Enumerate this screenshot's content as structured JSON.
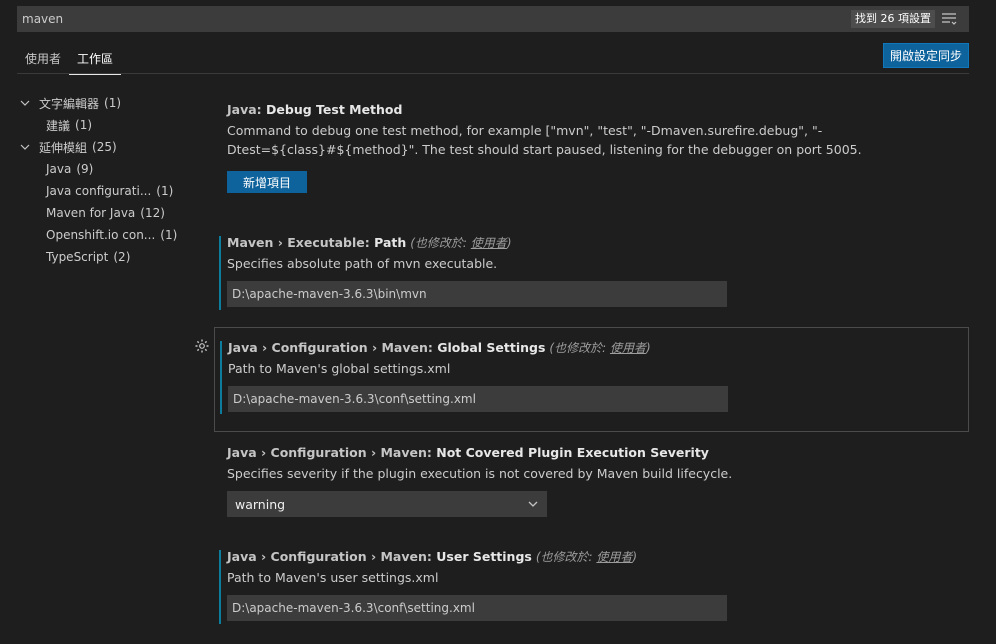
{
  "search": {
    "value": "maven",
    "count_badge": "找到 26 項設置"
  },
  "tabs": [
    {
      "label": "使用者"
    },
    {
      "label": "工作區"
    }
  ],
  "sync_button": "開啟設定同步",
  "toc": [
    {
      "label": "文字編輯器",
      "count": "(1)",
      "expanded": true,
      "level": 0
    },
    {
      "label": "建議",
      "count": "(1)",
      "level": 1
    },
    {
      "label": "延伸模組",
      "count": "(25)",
      "expanded": true,
      "level": 0
    },
    {
      "label": "Java",
      "count": "(9)",
      "level": 1
    },
    {
      "label": "Java configurati...",
      "count": "(1)",
      "level": 1
    },
    {
      "label": "Maven for Java",
      "count": "(12)",
      "level": 1
    },
    {
      "label": "Openshift.io con...",
      "count": "(1)",
      "level": 1
    },
    {
      "label": "TypeScript",
      "count": "(2)",
      "level": 1
    }
  ],
  "settings": [
    {
      "category": "Java: ",
      "key": "Debug Test Method",
      "description": "Command to debug one test method, for example [\"mvn\", \"test\", \"-Dmaven.surefire.debug\", \"-Dtest=${class}#${method}\". The test should start paused, listening for the debugger on port 5005.",
      "button": "新增項目"
    },
    {
      "category": "Maven › Executable: ",
      "key": "Path",
      "modified_prefix": "(也修改於: ",
      "modified_link": "使用者",
      "modified_suffix": ")",
      "description": "Specifies absolute path of mvn executable.",
      "value": "D:\\apache-maven-3.6.3\\bin\\mvn"
    },
    {
      "category": "Java › Configuration › Maven: ",
      "key": "Global Settings",
      "modified_prefix": "(也修改於: ",
      "modified_link": "使用者",
      "modified_suffix": ")",
      "description": "Path to Maven's global settings.xml",
      "value": "D:\\apache-maven-3.6.3\\conf\\setting.xml"
    },
    {
      "category": "Java › Configuration › Maven: ",
      "key": "Not Covered Plugin Execution Severity",
      "description": "Specifies severity if the plugin execution is not covered by Maven build lifecycle.",
      "value": "warning"
    },
    {
      "category": "Java › Configuration › Maven: ",
      "key": "User Settings",
      "modified_prefix": "(也修改於: ",
      "modified_link": "使用者",
      "modified_suffix": ")",
      "description": "Path to Maven's user settings.xml",
      "value": "D:\\apache-maven-3.6.3\\conf\\setting.xml"
    }
  ],
  "colors": {
    "accent": "#0e639c",
    "modified_bar": "#0c7d9d",
    "background": "#1e1e1e"
  }
}
